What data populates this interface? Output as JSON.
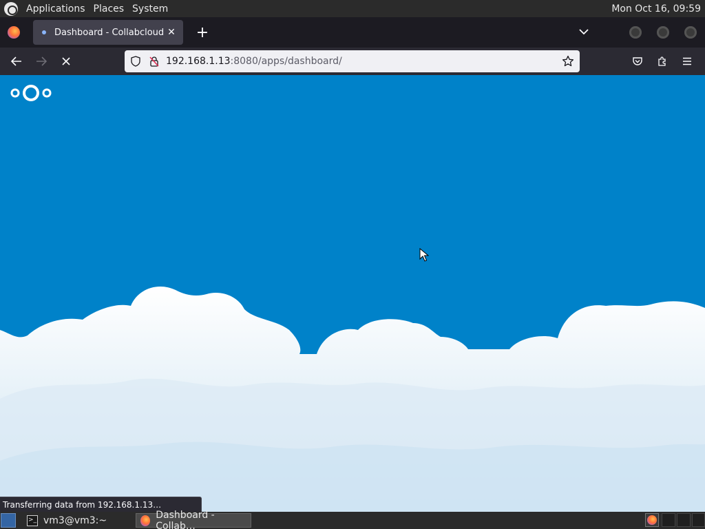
{
  "top_panel": {
    "menus": [
      "Applications",
      "Places",
      "System"
    ],
    "clock": "Mon Oct 16, 09:59"
  },
  "browser": {
    "tab_title": "Dashboard - Collabcloud",
    "url_host": "192.168.1.13",
    "url_rest": ":8080/apps/dashboard/",
    "status_text": "Transferring data from 192.168.1.13…",
    "theme": {
      "content_bg": "#0082c9",
      "toolbar_bg": "#2b2a33",
      "tabbar_bg": "#1c1b22"
    }
  },
  "taskbar": {
    "terminal_label": "vm3@vm3:~",
    "firefox_label": "Dashboard - Collab…"
  },
  "icons": {
    "logo": "nextcloud-logo",
    "back": "arrow-left-icon",
    "forward": "arrow-right-icon",
    "stop": "close-icon",
    "shield": "shield-icon",
    "lock": "insecure-lock-icon",
    "bookmark": "star-icon",
    "pocket": "pocket-icon",
    "extensions": "puzzle-icon",
    "menu": "hamburger-icon"
  }
}
